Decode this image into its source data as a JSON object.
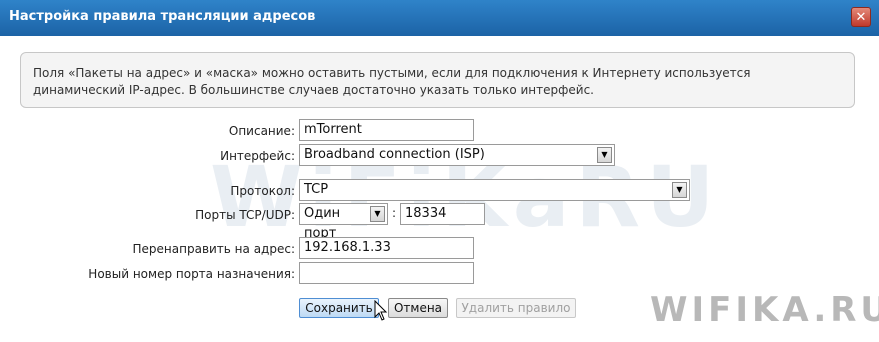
{
  "dialog": {
    "title": "Настройка правила трансляции адресов",
    "close_label": "✕"
  },
  "info": {
    "text": "Поля «Пакеты на адрес» и «маска» можно оставить пустыми, если для подключения к Интернету используется динамический IP-адрес. В большинстве случаев достаточно указать только интерфейс."
  },
  "form": {
    "description": {
      "label": "Описание:",
      "value": "mTorrent"
    },
    "interface": {
      "label": "Интерфейс:",
      "value": "Broadband connection (ISP)"
    },
    "protocol": {
      "label": "Протокол:",
      "value": "TCP"
    },
    "ports": {
      "label": "Порты TCP/UDP:",
      "mode": "Один порт",
      "separator": ":",
      "value": "18334"
    },
    "redirect": {
      "label": "Перенаправить на адрес:",
      "value": "192.168.1.33"
    },
    "dest_port": {
      "label": "Новый номер порта назначения:",
      "value": ""
    }
  },
  "buttons": {
    "save": "Сохранить",
    "cancel": "Отмена",
    "delete": "Удалить правило"
  },
  "watermarks": {
    "center": "WiFiKaRU",
    "corner": "WIFIKA.RU"
  },
  "colors": {
    "titlebar": "#1c63a6",
    "save_button": "#bedaf4"
  }
}
